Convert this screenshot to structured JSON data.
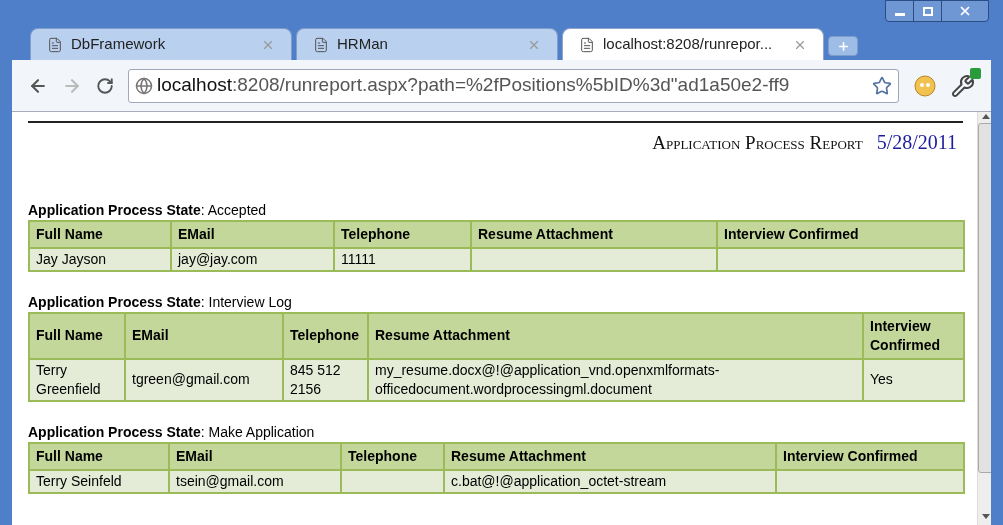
{
  "browser": {
    "tabs": [
      {
        "title": "DbFramework",
        "selected": false
      },
      {
        "title": "HRMan",
        "selected": false
      },
      {
        "title": "localhost:8208/runrepor...",
        "selected": true
      }
    ],
    "address": {
      "host": "localhost",
      "rest": ":8208/runreport.aspx?path=%2fPositions%5bID%3d\"ad1a50e2-ff9"
    }
  },
  "report": {
    "title": "Application Process Report",
    "date": "5/28/2011",
    "sections": [
      {
        "heading": "**Application Process State**: Accepted",
        "columns": [
          "Full Name",
          "EMail",
          "Telephone",
          "Resume Attachment",
          "Interview Confirmed"
        ],
        "rows": [
          [
            "Jay Jayson",
            "jay@jay.com",
            "11111",
            null,
            null
          ]
        ]
      },
      {
        "heading": "**Application Process State**: Interview Log",
        "columns": [
          "Full Name",
          "EMail",
          "Telephone",
          "Resume Attachment",
          "Interview Confirmed"
        ],
        "rows": [
          [
            "Terry Greenfield",
            "tgreen@gmail.com",
            "845 512 2156",
            "my_resume.docx@!@application_vnd.openxmlformats-officedocument.wordprocessingml.document",
            "Yes"
          ]
        ]
      },
      {
        "heading": "**Application Process State**: Make Application",
        "columns": [
          "Full Name",
          "EMail",
          "Telephone",
          "Resume Attachment",
          "Interview Confirmed"
        ],
        "rows": [
          [
            "Terry Seinfeld",
            "tsein@gmail.com",
            null,
            "c.bat@!@application_octet-stream",
            null
          ]
        ]
      }
    ]
  }
}
